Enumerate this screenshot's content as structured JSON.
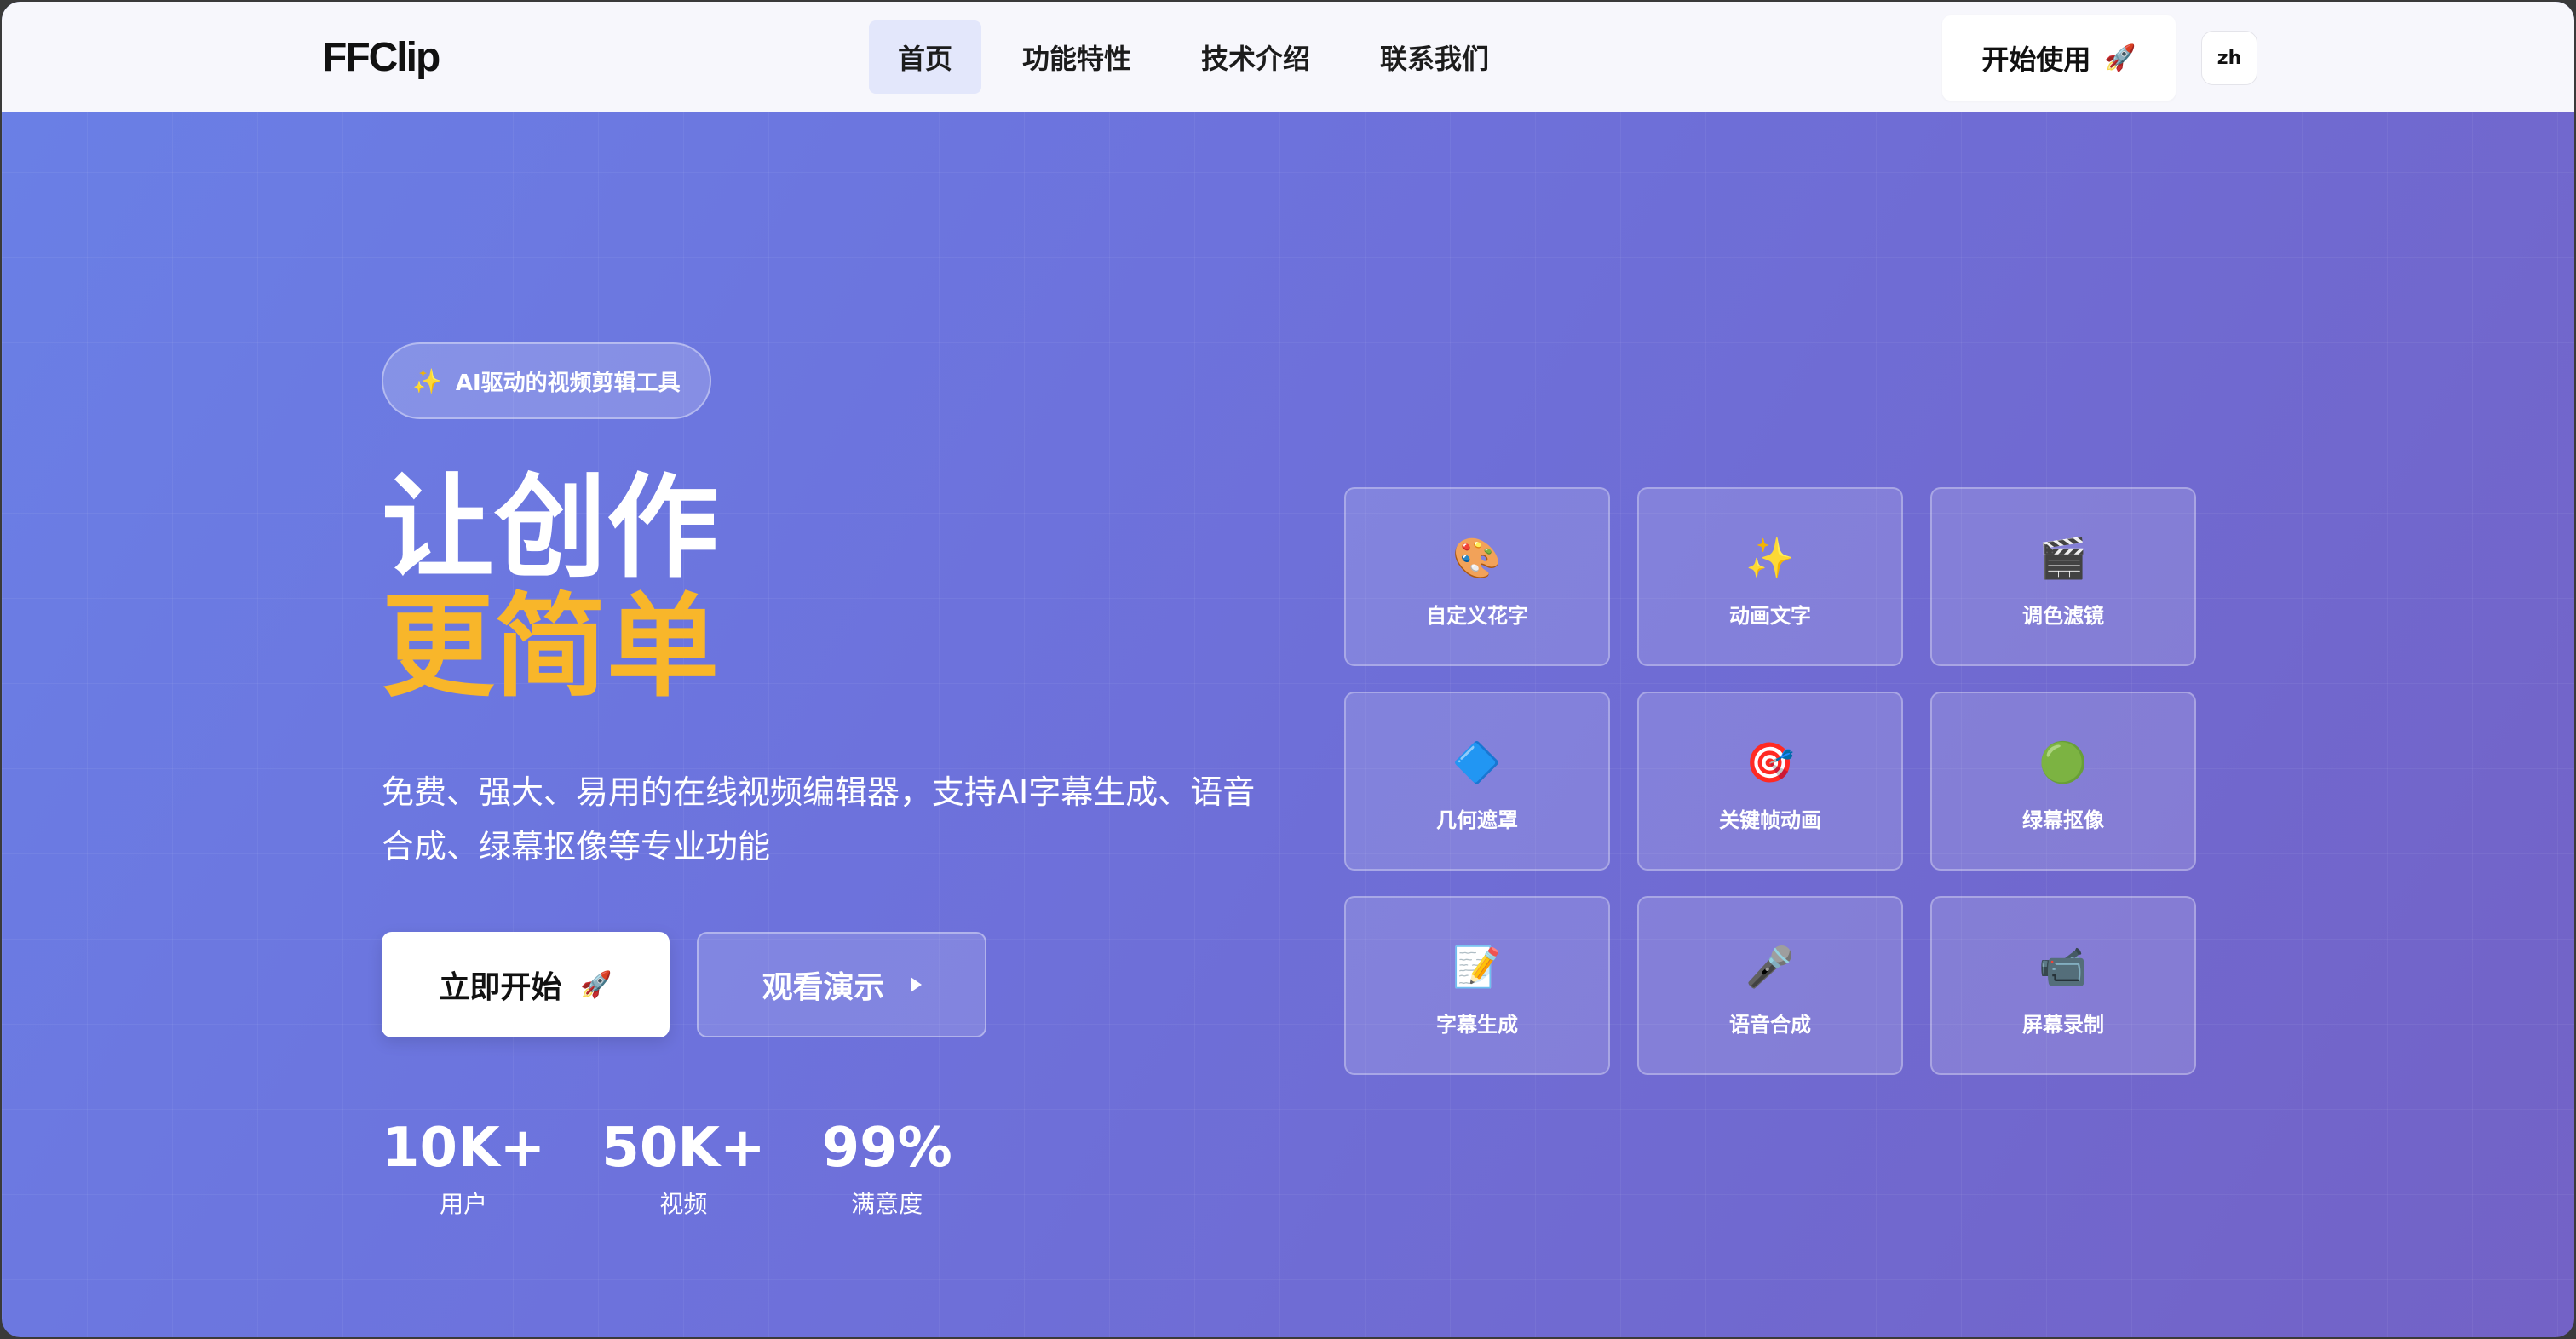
{
  "nav": {
    "logo": "FFClip",
    "links": [
      {
        "label": "首页",
        "active": true
      },
      {
        "label": "功能特性",
        "active": false
      },
      {
        "label": "技术介绍",
        "active": false
      },
      {
        "label": "联系我们",
        "active": false
      }
    ],
    "start_label": "开始使用",
    "start_icon": "rocket-icon",
    "lang": "zh"
  },
  "hero": {
    "badge_icon": "sparkles-icon",
    "badge_text": "AI驱动的视频剪辑工具",
    "headline_line1": "让创作",
    "headline_line2": "更简单",
    "subtitle": "免费、强大、易用的在线视频编辑器，支持AI字幕生成、语音合成、绿幕抠像等专业功能",
    "primary_button": "立即开始",
    "secondary_button": "观看演示",
    "stats": [
      {
        "value": "10K+",
        "label": "用户"
      },
      {
        "value": "50K+",
        "label": "视频"
      },
      {
        "value": "99%",
        "label": "满意度"
      }
    ]
  },
  "features": [
    {
      "label": "自定义花字",
      "icon": "palette-icon",
      "glyph": "🎨"
    },
    {
      "label": "动画文字",
      "icon": "sparkles-icon",
      "glyph": "✨"
    },
    {
      "label": "调色滤镜",
      "icon": "clapperboard-icon",
      "glyph": "🎬"
    },
    {
      "label": "几何遮罩",
      "icon": "blue-diamond-icon",
      "glyph": "🔷"
    },
    {
      "label": "关键帧动画",
      "icon": "target-icon",
      "glyph": "🎯"
    },
    {
      "label": "绿幕抠像",
      "icon": "green-circle-icon",
      "glyph": "🟢"
    },
    {
      "label": "字幕生成",
      "icon": "memo-icon",
      "glyph": "📝"
    },
    {
      "label": "语音合成",
      "icon": "microphone-icon",
      "glyph": "🎤"
    },
    {
      "label": "屏幕录制",
      "icon": "video-camera-icon",
      "glyph": "📹"
    }
  ],
  "colors": {
    "accent_yellow": "#f8b62a",
    "gradient_start": "#6a80e6",
    "gradient_end": "#7362c6",
    "nav_active_bg": "#e3e7fb"
  }
}
